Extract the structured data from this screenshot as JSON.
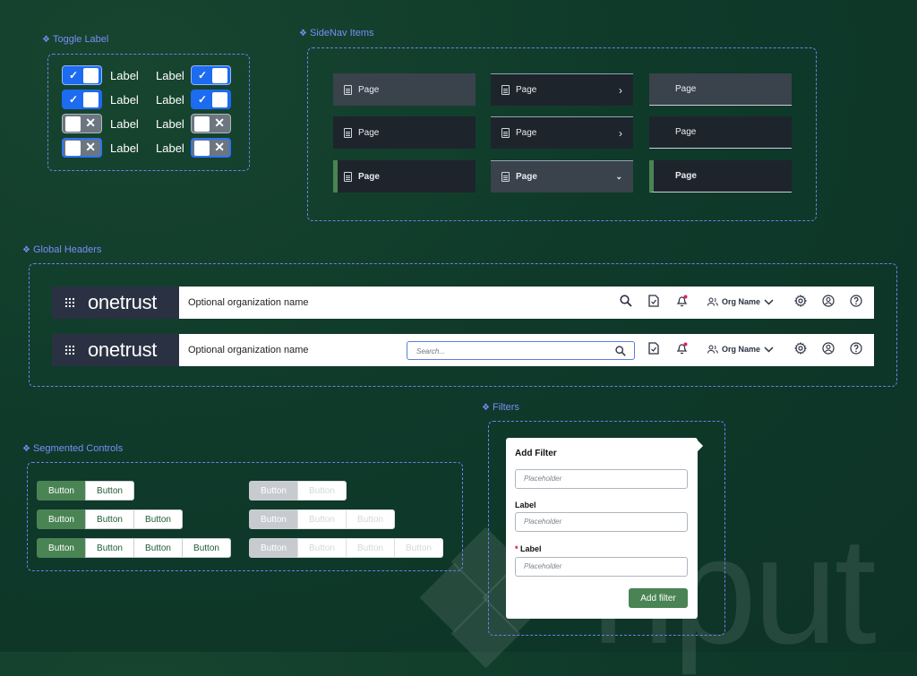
{
  "sections": {
    "toggle": "Toggle Label",
    "sidenav": "SideNav Items",
    "headers": "Global Headers",
    "segmented": "Segmented Controls",
    "filters": "Filters"
  },
  "toggle_label": "Label",
  "sidenav_label": "Page",
  "header": {
    "logo": "onetrust",
    "org_placeholder": "Optional organization name",
    "search_placeholder": "Search...",
    "org_select": "Org Name"
  },
  "segmented_label": "Button",
  "filter": {
    "title": "Add Filter",
    "field1_placeholder": "Placeholder",
    "field2_label": "Label",
    "field2_placeholder": "Placeholder",
    "field3_required": "*",
    "field3_label": "Label",
    "field3_placeholder": "Placeholder",
    "button": "Add filter"
  },
  "watermark": "nput",
  "colors": {
    "accent_green": "#4a8454",
    "toggle_blue": "#1c6bf0",
    "nav_dark": "#1e242c",
    "dashed": "#6f7fe8"
  }
}
